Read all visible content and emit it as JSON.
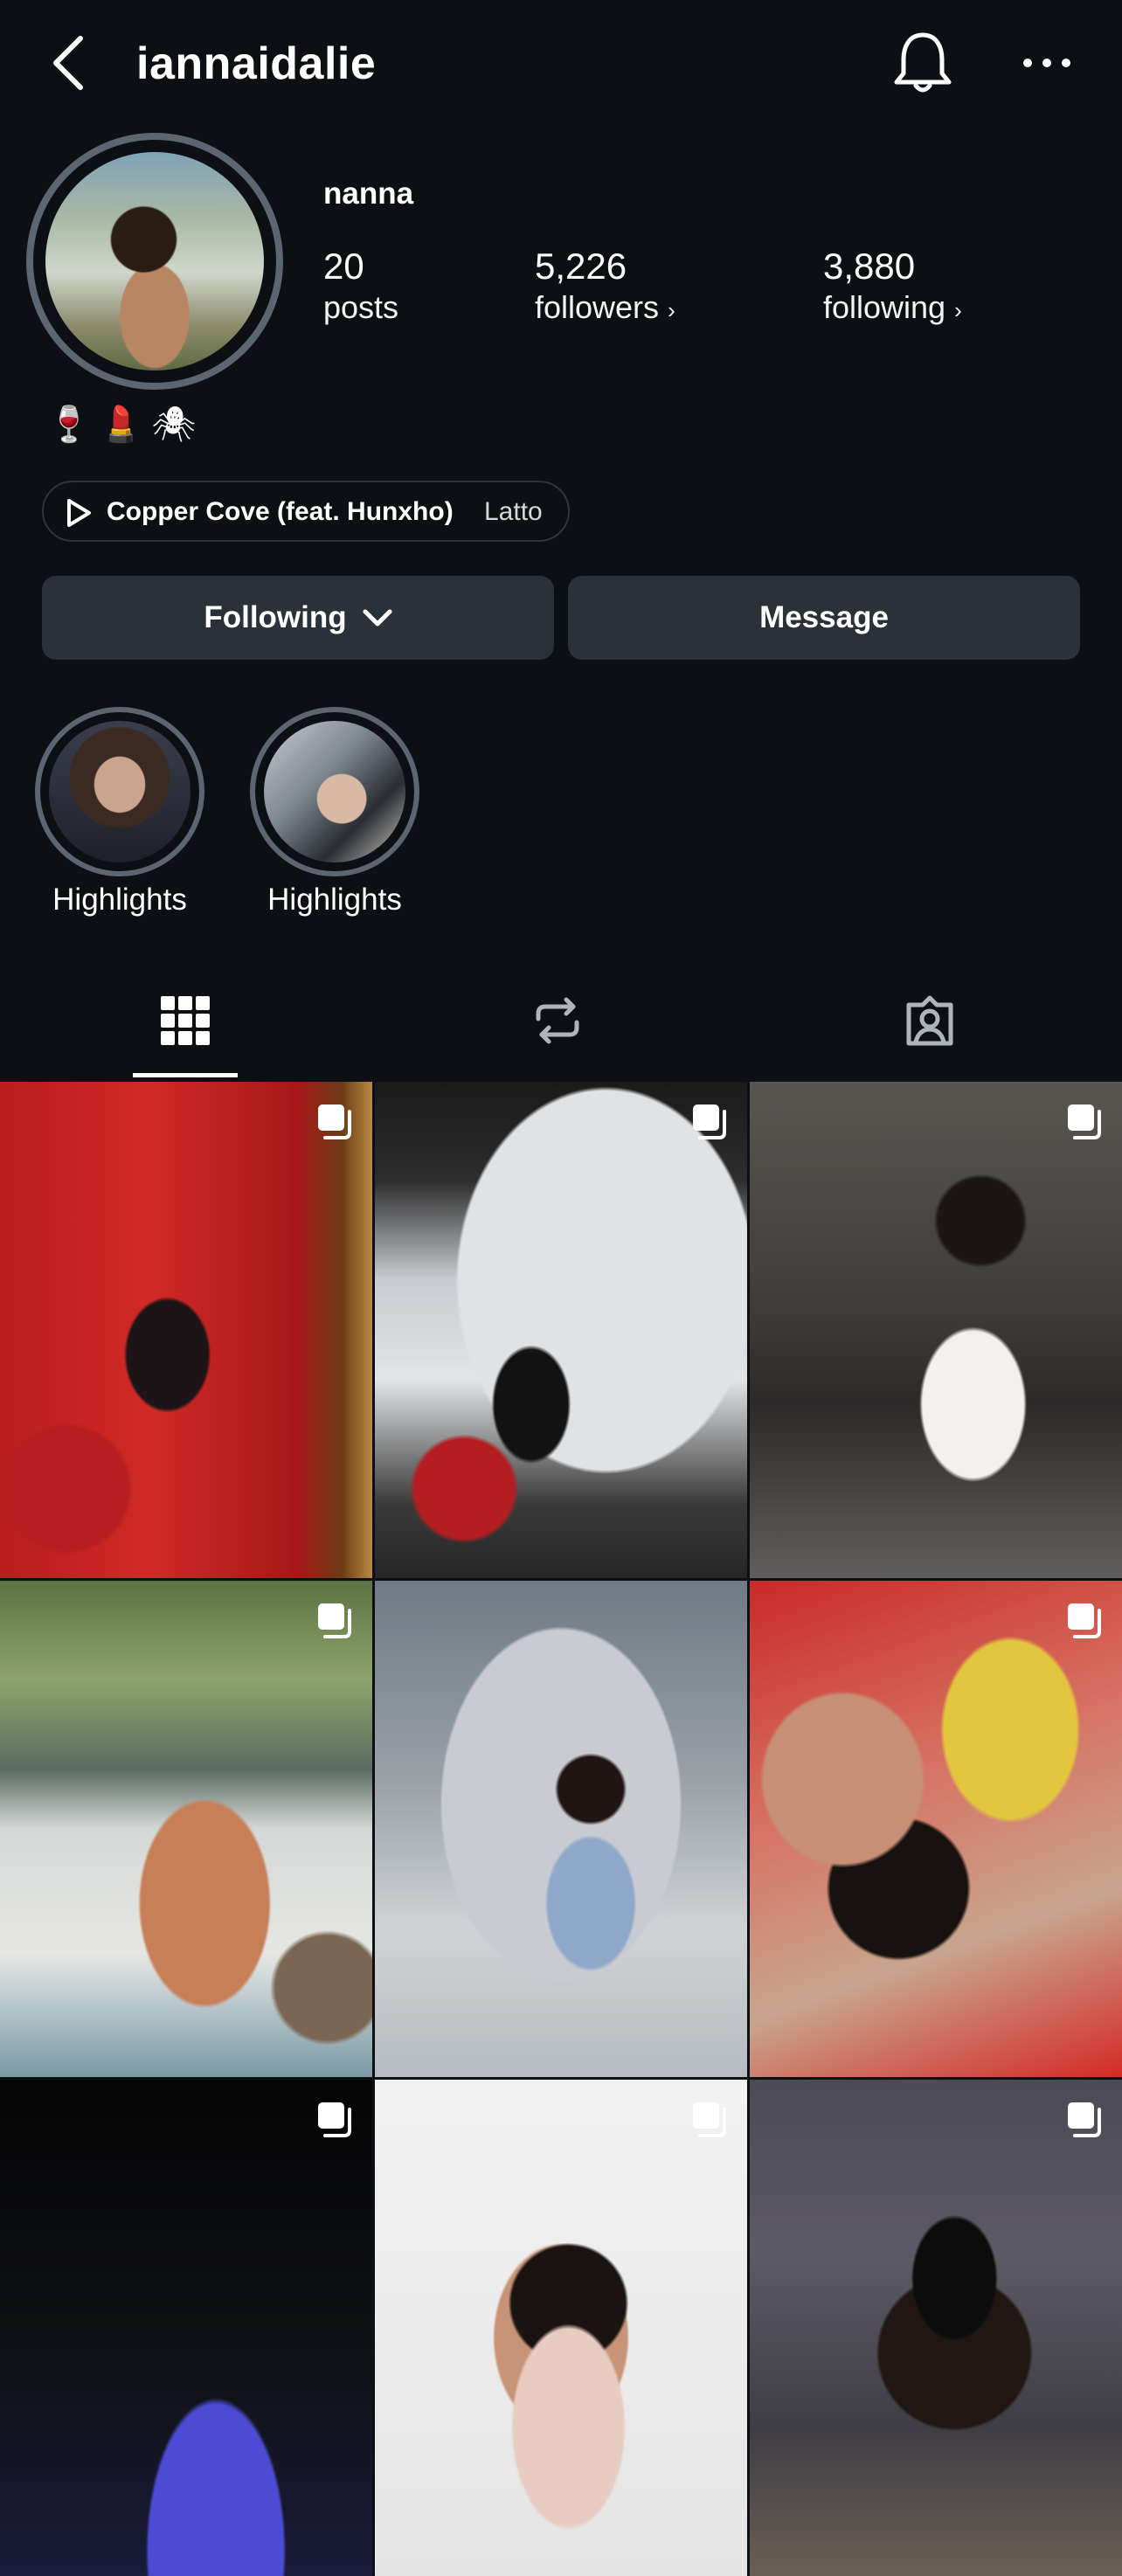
{
  "header": {
    "username": "iannaidalie",
    "back_icon": "chevron-left-icon",
    "bell_icon": "bell-icon",
    "more_icon": "more-horizontal-icon"
  },
  "profile": {
    "display_name": "nanna",
    "stats": [
      {
        "value": "20",
        "label": "posts"
      },
      {
        "value": "5,226",
        "label": "followers"
      },
      {
        "value": "3,880",
        "label": "following"
      }
    ],
    "bio_emojis": "🍷💄🕷",
    "music": {
      "title": "Copper Cove (feat. Hunxho)",
      "artist": "Latto"
    }
  },
  "actions": {
    "following_label": "Following",
    "message_label": "Message"
  },
  "highlights": [
    {
      "label": "Highlights"
    },
    {
      "label": "Highlights"
    }
  ],
  "tabs": [
    {
      "name": "grid-icon",
      "selected": true
    },
    {
      "name": "reposts-icon",
      "selected": false
    },
    {
      "name": "tagged-icon",
      "selected": false
    }
  ],
  "colors": {
    "background": "#0c1014",
    "button": "#2b3138",
    "ring": "#5d6670"
  }
}
